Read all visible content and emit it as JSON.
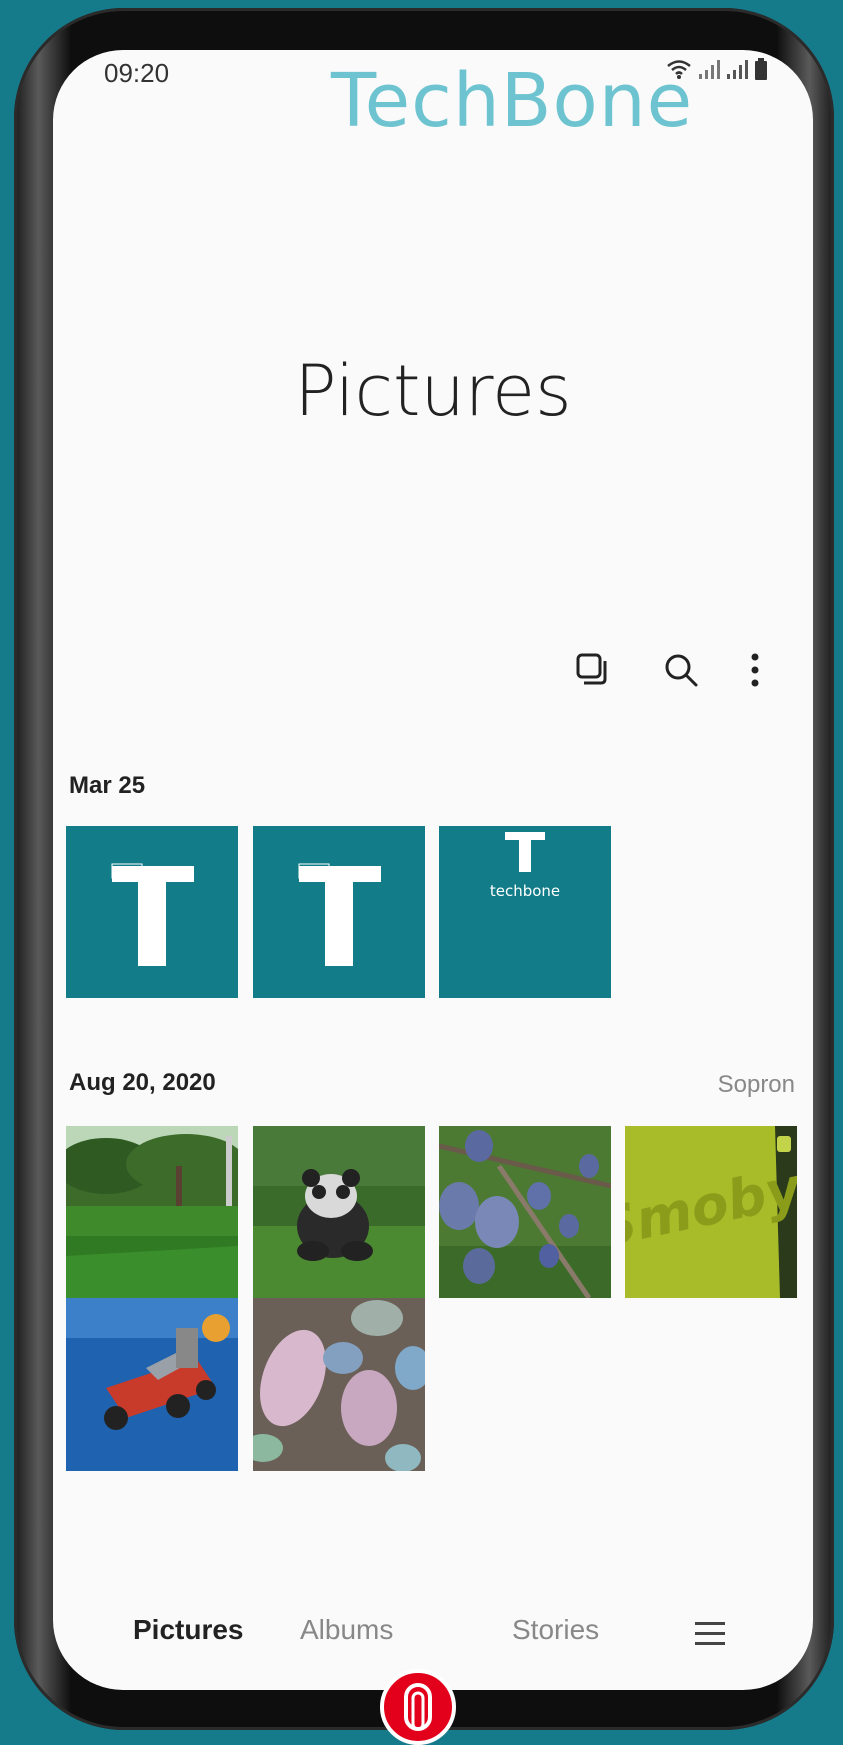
{
  "status": {
    "time": "09:20"
  },
  "watermark": "TechBone",
  "page_title": "Pictures",
  "toolbar": {
    "select_icon": "select-icon",
    "search_icon": "search-icon",
    "more_icon": "more-vert-icon"
  },
  "sections": [
    {
      "date": "Mar 25",
      "location": "",
      "thumbs": [
        "techbone-logo-1",
        "techbone-logo-2",
        "techbone-logo-3"
      ],
      "logo_text": "techbone"
    },
    {
      "date": "Aug 20, 2020",
      "location": "Sopron",
      "thumbs": [
        "lawn-photo",
        "panda-toy-photo",
        "plums-photo",
        "smoby-photo",
        "toy-car-photo",
        "chalk-photo"
      ],
      "smoby_text": "Smoby"
    }
  ],
  "nav": {
    "pictures": "Pictures",
    "albums": "Albums",
    "stories": "Stories",
    "menu_icon": "menu-icon"
  },
  "colors": {
    "accent_tile": "#127c89",
    "background": "#157a8a"
  }
}
